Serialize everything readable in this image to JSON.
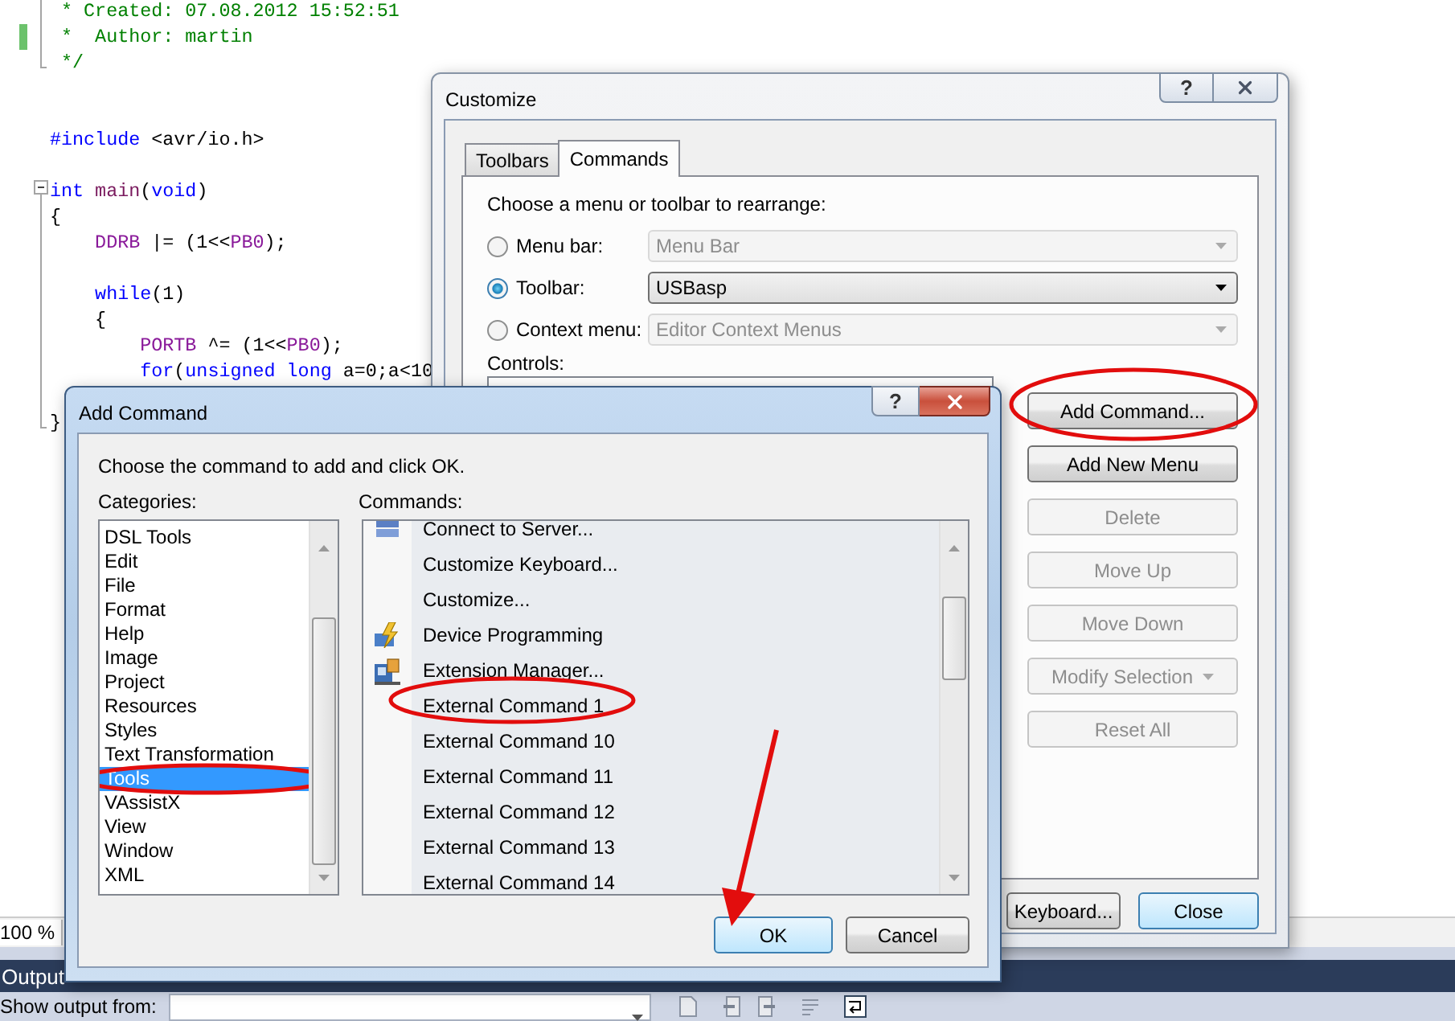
{
  "editor": {
    "lines": [
      {
        "kind": "code",
        "changed": false,
        "tokens": [
          {
            "text": " * Created: 07.08.2012 15:52:51",
            "kind": "comment"
          }
        ]
      },
      {
        "kind": "code",
        "changed": true,
        "tokens": [
          {
            "text": " *  Author: martin",
            "kind": "comment"
          }
        ]
      },
      {
        "kind": "code",
        "changed": false,
        "tokens": [
          {
            "text": " */",
            "kind": "comment"
          }
        ]
      },
      {
        "kind": "blank"
      },
      {
        "kind": "blank"
      },
      {
        "kind": "code",
        "changed": false,
        "tokens": [
          {
            "text": "#include",
            "kind": "keyword"
          },
          {
            "text": " <avr/io.h>",
            "kind": "plain"
          }
        ]
      },
      {
        "kind": "blank"
      },
      {
        "kind": "code",
        "changed": false,
        "tokens": [
          {
            "text": "int",
            "kind": "keyword"
          },
          {
            "text": " main",
            "kind": "function"
          },
          {
            "text": "(",
            "kind": "plain"
          },
          {
            "text": "void",
            "kind": "keyword"
          },
          {
            "text": ")",
            "kind": "plain"
          }
        ]
      },
      {
        "kind": "code",
        "changed": false,
        "tokens": [
          {
            "text": "{",
            "kind": "plain"
          }
        ]
      },
      {
        "kind": "code",
        "changed": false,
        "tokens": [
          {
            "text": "    DDRB",
            "kind": "macro"
          },
          {
            "text": " |= (1<<",
            "kind": "plain"
          },
          {
            "text": "PB0",
            "kind": "macro"
          },
          {
            "text": ");",
            "kind": "plain"
          }
        ]
      },
      {
        "kind": "blank"
      },
      {
        "kind": "code",
        "changed": false,
        "tokens": [
          {
            "text": "    while",
            "kind": "keyword"
          },
          {
            "text": "(1)",
            "kind": "plain"
          }
        ]
      },
      {
        "kind": "code",
        "changed": false,
        "tokens": [
          {
            "text": "    {",
            "kind": "plain"
          }
        ]
      },
      {
        "kind": "code",
        "changed": false,
        "tokens": [
          {
            "text": "        PORTB",
            "kind": "macro"
          },
          {
            "text": " ^= (1<<",
            "kind": "plain"
          },
          {
            "text": "PB0",
            "kind": "macro"
          },
          {
            "text": ");",
            "kind": "plain"
          }
        ]
      },
      {
        "kind": "code",
        "changed": false,
        "tokens": [
          {
            "text": "        for",
            "kind": "keyword"
          },
          {
            "text": "(",
            "kind": "plain"
          },
          {
            "text": "unsigned long",
            "kind": "keyword"
          },
          {
            "text": " a=0;a<10",
            "kind": "plain"
          }
        ]
      },
      {
        "kind": "blank"
      },
      {
        "kind": "code",
        "changed": false,
        "tokens": [
          {
            "text": "}",
            "kind": "plain"
          }
        ]
      }
    ],
    "zoom": "100 %"
  },
  "customize": {
    "title": "Customize",
    "help": "?",
    "tabs": [
      {
        "label": "Toolbars",
        "selected": false
      },
      {
        "label": "Commands",
        "selected": true
      }
    ],
    "prompt": "Choose a menu or toolbar to rearrange:",
    "options": [
      {
        "label": "Menu bar:",
        "selected": false,
        "value": "Menu Bar"
      },
      {
        "label": "Toolbar:",
        "selected": true,
        "value": "USBasp"
      },
      {
        "label": "Context menu:",
        "selected": false,
        "value": "Editor Context Menus"
      }
    ],
    "controls_label": "Controls:",
    "side_buttons": [
      {
        "label": "Add Command...",
        "kind": "plain",
        "disabled": false,
        "circled": true
      },
      {
        "label": "Add New Menu",
        "kind": "plain",
        "disabled": false,
        "circled": false
      },
      {
        "label": "Delete",
        "kind": "plain",
        "disabled": true,
        "circled": false
      },
      {
        "label": "Move Up",
        "kind": "plain",
        "disabled": true,
        "circled": false
      },
      {
        "label": "Move Down",
        "kind": "plain",
        "disabled": true,
        "circled": false
      },
      {
        "label": "Modify Selection",
        "kind": "menu",
        "disabled": true,
        "circled": false
      },
      {
        "label": "Reset All",
        "kind": "plain",
        "disabled": true,
        "circled": false
      }
    ],
    "footer_buttons": [
      {
        "label": "Keyboard...",
        "default": false
      },
      {
        "label": "Close",
        "default": true
      }
    ]
  },
  "add_command": {
    "title": "Add Command",
    "help": "?",
    "prompt": "Choose the command to add and click OK.",
    "categories": {
      "label": "Categories:",
      "items": [
        {
          "label": "DSL Tools",
          "selected": false,
          "circled": false
        },
        {
          "label": "Edit",
          "selected": false,
          "circled": false
        },
        {
          "label": "File",
          "selected": false,
          "circled": false
        },
        {
          "label": "Format",
          "selected": false,
          "circled": false
        },
        {
          "label": "Help",
          "selected": false,
          "circled": false
        },
        {
          "label": "Image",
          "selected": false,
          "circled": false
        },
        {
          "label": "Project",
          "selected": false,
          "circled": false
        },
        {
          "label": "Resources",
          "selected": false,
          "circled": false
        },
        {
          "label": "Styles",
          "selected": false,
          "circled": false
        },
        {
          "label": "Text Transformation",
          "selected": false,
          "circled": false
        },
        {
          "label": "Tools",
          "selected": true,
          "circled": true
        },
        {
          "label": "VAssistX",
          "selected": false,
          "circled": false
        },
        {
          "label": "View",
          "selected": false,
          "circled": false
        },
        {
          "label": "Window",
          "selected": false,
          "circled": false
        },
        {
          "label": "XML",
          "selected": false,
          "circled": false
        }
      ]
    },
    "commands": {
      "label": "Commands:",
      "items": [
        {
          "label": "Connect to Server...",
          "circled": false
        },
        {
          "label": "Customize Keyboard...",
          "circled": false
        },
        {
          "label": "Customize...",
          "circled": false
        },
        {
          "label": "Device Programming",
          "circled": false
        },
        {
          "label": "Extension Manager...",
          "circled": false
        },
        {
          "label": "External Command 1",
          "circled": true
        },
        {
          "label": "External Command 10",
          "circled": false
        },
        {
          "label": "External Command 11",
          "circled": false
        },
        {
          "label": "External Command 12",
          "circled": false
        },
        {
          "label": "External Command 13",
          "circled": false
        },
        {
          "label": "External Command 14",
          "circled": false
        }
      ]
    },
    "buttons": [
      {
        "label": "OK",
        "default": true,
        "pointed": true
      },
      {
        "label": "Cancel",
        "default": false,
        "pointed": false
      }
    ]
  },
  "output": {
    "title": "Output",
    "show_label": "Show output from:"
  }
}
